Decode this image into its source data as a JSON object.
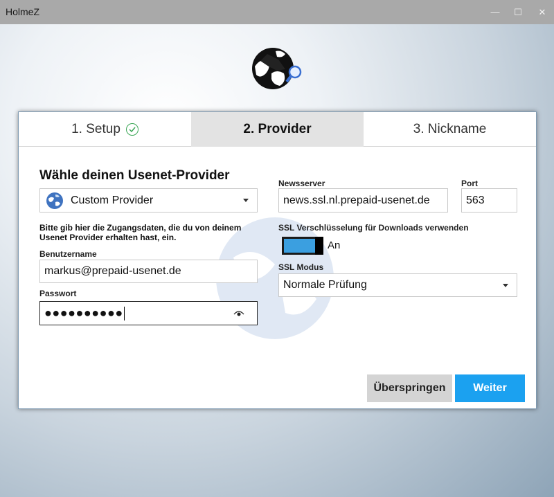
{
  "window": {
    "title": "HolmeZ",
    "minimize_glyph": "—",
    "maximize_glyph": "☐",
    "close_glyph": "✕"
  },
  "tabs": [
    {
      "label": "1. Setup",
      "state": "done"
    },
    {
      "label": "2. Provider",
      "state": "active"
    },
    {
      "label": "3. Nickname",
      "state": "pending"
    }
  ],
  "form": {
    "heading": "Wähle deinen Usenet-Provider",
    "provider_value": "Custom Provider",
    "hint": "Bitte gib hier die Zugangsdaten, die du von deinem Usenet Provider erhalten hast, ein.",
    "username_label": "Benutzername",
    "username_value": "markus@prepaid-usenet.de",
    "password_label": "Passwort",
    "password_mask": "●●●●●●●●●●",
    "newsserver_label": "Newsserver",
    "newsserver_value": "news.ssl.nl.prepaid-usenet.de",
    "port_label": "Port",
    "port_value": "563",
    "ssl_label": "SSL Verschlüsselung für Downloads verwenden",
    "ssl_toggle_text": "An",
    "ssl_mode_label": "SSL Modus",
    "ssl_mode_value": "Normale Prüfung"
  },
  "buttons": {
    "skip": "Überspringen",
    "next": "Weiter"
  },
  "colors": {
    "accent": "#1ba1f0",
    "toggle_on": "#3b9fe0",
    "titlebar": "#a9a9a9",
    "check": "#3aa655"
  },
  "icons": {
    "logo": "detective-globe-logo",
    "provider": "globe-icon",
    "password_reveal": "eye-icon",
    "setup_done": "check-circle-icon"
  }
}
